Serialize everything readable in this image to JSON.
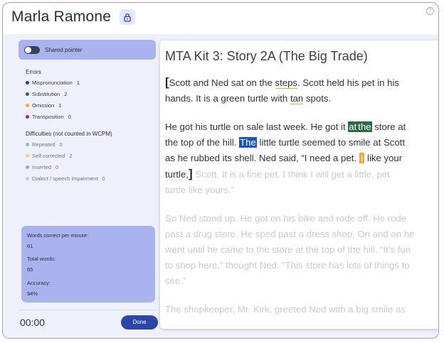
{
  "header": {
    "student_name": "Marla Ramone",
    "lock_icon": "lock-icon",
    "help_icon": "help-icon"
  },
  "sidebar": {
    "shared_pointer_label": "Shared pointer",
    "errors_title": "Errors",
    "errors": [
      {
        "label": "Mispronunciation",
        "count": "1",
        "color": "#2b3c8f"
      },
      {
        "label": "Substitution",
        "count": "2",
        "color": "#2c6b46"
      },
      {
        "label": "Omission",
        "count": "1",
        "color": "#f0a53a"
      },
      {
        "label": "Transposition",
        "count": "0",
        "color": "#9b2f4a"
      }
    ],
    "difficulties_title": "Difficulties (not counted in WCPM)",
    "difficulties": [
      {
        "label": "Repeated",
        "count": "0",
        "color": "#8fbf9a"
      },
      {
        "label": "Self corrected",
        "count": "2",
        "color": "#f4d27a"
      },
      {
        "label": "Inserted",
        "count": "0",
        "color": "#8ea4e6"
      },
      {
        "label": "Dialect / speech impairment",
        "count": "0",
        "color": "#c9ccd6"
      }
    ],
    "stats": {
      "wcpm_label": "Words correct per minute:",
      "wcpm_value": "61",
      "total_label": "Total words:",
      "total_value": "65",
      "accuracy_label": "Accuracy:",
      "accuracy_value": "94%"
    },
    "timer": "00:00",
    "done_label": "Done"
  },
  "passage": {
    "title": "MTA Kit 3: Story 2A (The Big Trade)",
    "p1": {
      "bracket_open": "[",
      "l1_a": "Scott and Ned sat on the ",
      "l1_steps": "steps",
      "l1_b": ". Scott held his pet in his",
      "l2_a": "hands. It is a green turtle with ",
      "l2_tan": "tan",
      "l2_b": " spots."
    },
    "p2": {
      "l1_a": "He got his turtle on sale last week. He got it ",
      "l1_at": "at",
      "l1_the": "the",
      "l1_b": " store at",
      "l2_a": "the top of the hill. ",
      "l2_the": "The",
      "l2_b": " little turtle seemed to smile at Scott",
      "l3_a": "as he rubbed its shell. Ned said, “I need a pet. ",
      "l3_i": "I",
      "l3_b": " like your",
      "l4_a": "turtle,",
      "bracket_close": "]",
      "l4_b": "  Scott. It is a fine pet. I think I will get a little, pet",
      "l5": "turtle like yours.”"
    },
    "p3": {
      "l1": "So Ned stood up. He got on his bike and rode off. He rode",
      "l2": "past a drug store. He sped past a dress shop. On and on he",
      "l3": "went until he came to the store at the top of the hill. “It’s fun",
      "l4": "to shop here,” thought Ned. “This store has lots of things to",
      "l5": "see.”"
    },
    "p4": {
      "l1": "The shopkeeper, Mr. Kirk, greeted Ned with a big smile as"
    }
  }
}
